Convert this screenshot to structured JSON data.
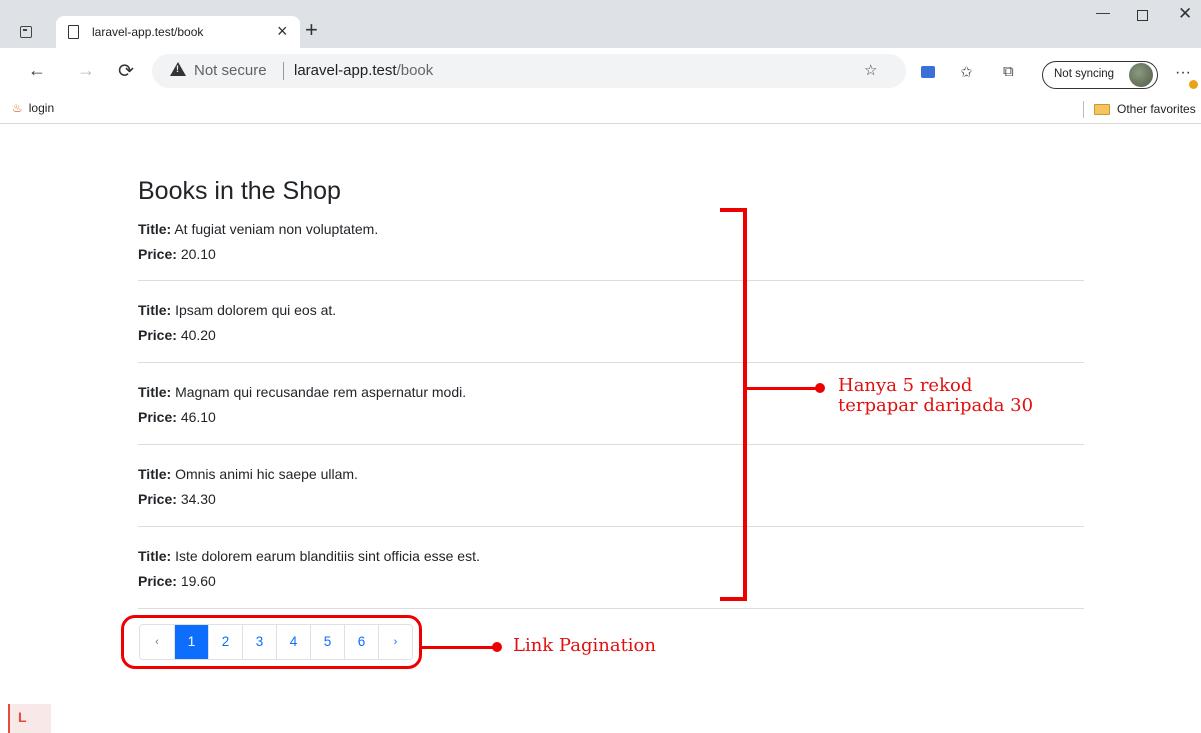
{
  "browser": {
    "tab_title": "laravel-app.test/book",
    "tab_close": "×",
    "new_tab": "+",
    "window_minimize": "—",
    "window_close": "✕",
    "nav_back": "←",
    "nav_forward": "→",
    "nav_reload": "⟳",
    "security_label": "Not secure",
    "url_host": "laravel-app.test",
    "url_path": "/book",
    "sync_label": "Not syncing",
    "more": "···",
    "icons": [
      "tab-menu-icon",
      "page-icon",
      "warning-icon",
      "read-aloud-icon",
      "extension-icon",
      "favorites-icon",
      "collections-icon",
      "profile-avatar-icon",
      "flame-icon",
      "folder-icon",
      "laravel-icon"
    ]
  },
  "favorites": {
    "login": "login",
    "other": "Other favorites"
  },
  "page": {
    "title": "Books in the Shop",
    "title_label": "Title:",
    "price_label": "Price:",
    "books": [
      {
        "title": "At fugiat veniam non voluptatem.",
        "price": "20.10"
      },
      {
        "title": "Ipsam dolorem qui eos at.",
        "price": "40.20"
      },
      {
        "title": "Magnam qui recusandae rem aspernatur modi.",
        "price": "46.10"
      },
      {
        "title": "Omnis animi hic saepe ullam.",
        "price": "34.30"
      },
      {
        "title": "Iste dolorem earum blanditiis sint officia esse est.",
        "price": "19.60"
      }
    ],
    "pagination": {
      "prev": "‹",
      "pages": [
        "1",
        "2",
        "3",
        "4",
        "5",
        "6"
      ],
      "active": "1",
      "next": "›"
    }
  },
  "annotations": {
    "records_line1": "Hanya 5 rekod",
    "records_line2": "terpapar daripada 30",
    "pagination_label": "Link Pagination",
    "color": "#ee0000"
  },
  "colors": {
    "accent": "#0d6efd",
    "annotation": "#ee0000"
  }
}
